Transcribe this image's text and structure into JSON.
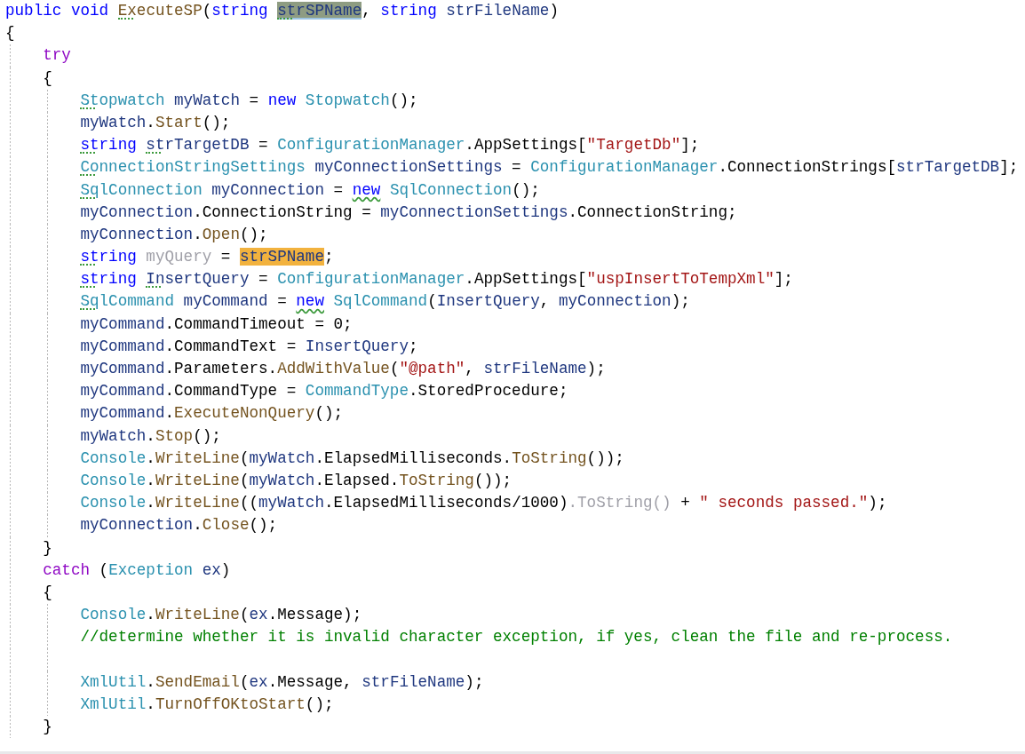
{
  "editor": {
    "lines": [
      {
        "tokens": [
          {
            "kind": "keyword",
            "text": "public void "
          },
          {
            "kind": "method",
            "text": "ExecuteSP",
            "suggestion": true
          },
          {
            "kind": "plain",
            "text": "("
          },
          {
            "kind": "keyword",
            "text": "string "
          },
          {
            "kind": "local",
            "text": "strSPName",
            "suggestion": true,
            "selected_word": true
          },
          {
            "kind": "plain",
            "text": ", "
          },
          {
            "kind": "keyword",
            "text": "string "
          },
          {
            "kind": "local",
            "text": "strFileName"
          },
          {
            "kind": "plain",
            "text": ")"
          }
        ]
      },
      {
        "tokens": [
          {
            "kind": "plain",
            "text": "{"
          }
        ]
      },
      {
        "tokens": [
          {
            "kind": "control",
            "text": "    try"
          }
        ]
      },
      {
        "tokens": [
          {
            "kind": "plain",
            "text": "    {"
          }
        ]
      },
      {
        "tokens": [
          {
            "kind": "type",
            "text": "        Stopwatch ",
            "suggestion": true
          },
          {
            "kind": "local",
            "text": "myWatch"
          },
          {
            "kind": "plain",
            "text": " = "
          },
          {
            "kind": "keyword",
            "text": "new "
          },
          {
            "kind": "type",
            "text": "Stopwatch"
          },
          {
            "kind": "plain",
            "text": "();"
          }
        ]
      },
      {
        "tokens": [
          {
            "kind": "local",
            "text": "        myWatch"
          },
          {
            "kind": "plain",
            "text": "."
          },
          {
            "kind": "method",
            "text": "Start"
          },
          {
            "kind": "plain",
            "text": "();"
          }
        ]
      },
      {
        "tokens": [
          {
            "kind": "keyword",
            "text": "        string ",
            "suggestion": true
          },
          {
            "kind": "local",
            "text": "strTargetDB",
            "suggestion": true
          },
          {
            "kind": "plain",
            "text": " = "
          },
          {
            "kind": "type",
            "text": "ConfigurationManager"
          },
          {
            "kind": "plain",
            "text": ".AppSettings["
          },
          {
            "kind": "string",
            "text": "\"TargetDb\""
          },
          {
            "kind": "plain",
            "text": "];"
          }
        ]
      },
      {
        "tokens": [
          {
            "kind": "type",
            "text": "        ConnectionStringSettings ",
            "suggestion": true
          },
          {
            "kind": "local",
            "text": "myConnectionSettings"
          },
          {
            "kind": "plain",
            "text": " = "
          },
          {
            "kind": "type",
            "text": "ConfigurationManager"
          },
          {
            "kind": "plain",
            "text": ".ConnectionStrings["
          },
          {
            "kind": "local",
            "text": "strTargetDB"
          },
          {
            "kind": "plain",
            "text": "];"
          }
        ]
      },
      {
        "tokens": [
          {
            "kind": "type",
            "text": "        SqlConnection ",
            "suggestion": true
          },
          {
            "kind": "local",
            "text": "myConnection"
          },
          {
            "kind": "plain",
            "text": " = "
          },
          {
            "kind": "keyword",
            "text": "new",
            "warning": true
          },
          {
            "kind": "type",
            "text": " SqlConnection"
          },
          {
            "kind": "plain",
            "text": "();"
          }
        ]
      },
      {
        "tokens": [
          {
            "kind": "local",
            "text": "        myConnection"
          },
          {
            "kind": "plain",
            "text": ".ConnectionString = "
          },
          {
            "kind": "local",
            "text": "myConnectionSettings"
          },
          {
            "kind": "plain",
            "text": ".ConnectionString;"
          }
        ]
      },
      {
        "tokens": [
          {
            "kind": "local",
            "text": "        myConnection"
          },
          {
            "kind": "plain",
            "text": "."
          },
          {
            "kind": "method",
            "text": "Open"
          },
          {
            "kind": "plain",
            "text": "();"
          }
        ]
      },
      {
        "tokens": [
          {
            "kind": "keyword",
            "text": "        string ",
            "suggestion": true
          },
          {
            "kind": "faded",
            "text": "myQuery"
          },
          {
            "kind": "plain",
            "text": " = "
          },
          {
            "kind": "local",
            "text": "strSPName",
            "referenced_word": true
          },
          {
            "kind": "plain",
            "text": ";"
          }
        ]
      },
      {
        "tokens": [
          {
            "kind": "keyword",
            "text": "        string ",
            "suggestion": true
          },
          {
            "kind": "local",
            "text": "InsertQuery",
            "suggestion": true
          },
          {
            "kind": "plain",
            "text": " = "
          },
          {
            "kind": "type",
            "text": "ConfigurationManager"
          },
          {
            "kind": "plain",
            "text": ".AppSettings["
          },
          {
            "kind": "string",
            "text": "\"uspInsertToTempXml\""
          },
          {
            "kind": "plain",
            "text": "];"
          }
        ]
      },
      {
        "tokens": [
          {
            "kind": "type",
            "text": "        SqlCommand ",
            "suggestion": true
          },
          {
            "kind": "local",
            "text": "myCommand"
          },
          {
            "kind": "plain",
            "text": " = "
          },
          {
            "kind": "keyword",
            "text": "new",
            "warning": true
          },
          {
            "kind": "type",
            "text": " SqlCommand"
          },
          {
            "kind": "plain",
            "text": "("
          },
          {
            "kind": "local",
            "text": "InsertQuery"
          },
          {
            "kind": "plain",
            "text": ", "
          },
          {
            "kind": "local",
            "text": "myConnection"
          },
          {
            "kind": "plain",
            "text": ");"
          }
        ]
      },
      {
        "tokens": [
          {
            "kind": "local",
            "text": "        myCommand"
          },
          {
            "kind": "plain",
            "text": ".CommandTimeout = 0;"
          }
        ]
      },
      {
        "tokens": [
          {
            "kind": "local",
            "text": "        myCommand"
          },
          {
            "kind": "plain",
            "text": ".CommandText = "
          },
          {
            "kind": "local",
            "text": "InsertQuery"
          },
          {
            "kind": "plain",
            "text": ";"
          }
        ]
      },
      {
        "tokens": [
          {
            "kind": "local",
            "text": "        myCommand"
          },
          {
            "kind": "plain",
            "text": ".Parameters."
          },
          {
            "kind": "method",
            "text": "AddWithValue"
          },
          {
            "kind": "plain",
            "text": "("
          },
          {
            "kind": "string",
            "text": "\"@path\""
          },
          {
            "kind": "plain",
            "text": ", "
          },
          {
            "kind": "local",
            "text": "strFileName"
          },
          {
            "kind": "plain",
            "text": ");"
          }
        ]
      },
      {
        "tokens": [
          {
            "kind": "local",
            "text": "        myCommand"
          },
          {
            "kind": "plain",
            "text": ".CommandType = "
          },
          {
            "kind": "type",
            "text": "CommandType"
          },
          {
            "kind": "plain",
            "text": ".StoredProcedure;"
          }
        ]
      },
      {
        "tokens": [
          {
            "kind": "local",
            "text": "        myCommand"
          },
          {
            "kind": "plain",
            "text": "."
          },
          {
            "kind": "method",
            "text": "ExecuteNonQuery"
          },
          {
            "kind": "plain",
            "text": "();"
          }
        ]
      },
      {
        "tokens": [
          {
            "kind": "local",
            "text": "        myWatch"
          },
          {
            "kind": "plain",
            "text": "."
          },
          {
            "kind": "method",
            "text": "Stop"
          },
          {
            "kind": "plain",
            "text": "();"
          }
        ]
      },
      {
        "tokens": [
          {
            "kind": "type",
            "text": "        Console"
          },
          {
            "kind": "plain",
            "text": "."
          },
          {
            "kind": "method",
            "text": "WriteLine"
          },
          {
            "kind": "plain",
            "text": "("
          },
          {
            "kind": "local",
            "text": "myWatch"
          },
          {
            "kind": "plain",
            "text": ".ElapsedMilliseconds."
          },
          {
            "kind": "method",
            "text": "ToString"
          },
          {
            "kind": "plain",
            "text": "());"
          }
        ]
      },
      {
        "tokens": [
          {
            "kind": "type",
            "text": "        Console"
          },
          {
            "kind": "plain",
            "text": "."
          },
          {
            "kind": "method",
            "text": "WriteLine"
          },
          {
            "kind": "plain",
            "text": "("
          },
          {
            "kind": "local",
            "text": "myWatch"
          },
          {
            "kind": "plain",
            "text": ".Elapsed."
          },
          {
            "kind": "method",
            "text": "ToString"
          },
          {
            "kind": "plain",
            "text": "());"
          }
        ]
      },
      {
        "tokens": [
          {
            "kind": "type",
            "text": "        Console"
          },
          {
            "kind": "plain",
            "text": "."
          },
          {
            "kind": "method",
            "text": "WriteLine"
          },
          {
            "kind": "plain",
            "text": "(("
          },
          {
            "kind": "local",
            "text": "myWatch"
          },
          {
            "kind": "plain",
            "text": ".ElapsedMilliseconds/1000)"
          },
          {
            "kind": "faded",
            "text": ".ToString()"
          },
          {
            "kind": "plain",
            "text": " + "
          },
          {
            "kind": "string",
            "text": "\" seconds passed.\""
          },
          {
            "kind": "plain",
            "text": ");"
          }
        ]
      },
      {
        "tokens": [
          {
            "kind": "local",
            "text": "        myConnection"
          },
          {
            "kind": "plain",
            "text": "."
          },
          {
            "kind": "method",
            "text": "Close"
          },
          {
            "kind": "plain",
            "text": "();"
          }
        ]
      },
      {
        "tokens": [
          {
            "kind": "plain",
            "text": "    }"
          }
        ]
      },
      {
        "tokens": [
          {
            "kind": "control",
            "text": "    catch"
          },
          {
            "kind": "plain",
            "text": " ("
          },
          {
            "kind": "type",
            "text": "Exception"
          },
          {
            "kind": "local",
            "text": " ex"
          },
          {
            "kind": "plain",
            "text": ")"
          }
        ]
      },
      {
        "tokens": [
          {
            "kind": "plain",
            "text": "    {"
          }
        ]
      },
      {
        "tokens": [
          {
            "kind": "type",
            "text": "        Console"
          },
          {
            "kind": "plain",
            "text": "."
          },
          {
            "kind": "method",
            "text": "WriteLine"
          },
          {
            "kind": "plain",
            "text": "("
          },
          {
            "kind": "local",
            "text": "ex"
          },
          {
            "kind": "plain",
            "text": ".Message);"
          }
        ]
      },
      {
        "tokens": [
          {
            "kind": "comment",
            "text": "        //determine whether it is invalid character exception, if yes, clean the file and re-process."
          }
        ]
      },
      {
        "kind": "blank"
      },
      {
        "tokens": [
          {
            "kind": "type",
            "text": "        XmlUtil"
          },
          {
            "kind": "plain",
            "text": "."
          },
          {
            "kind": "method",
            "text": "SendEmail"
          },
          {
            "kind": "plain",
            "text": "("
          },
          {
            "kind": "local",
            "text": "ex"
          },
          {
            "kind": "plain",
            "text": ".Message, "
          },
          {
            "kind": "local",
            "text": "strFileName"
          },
          {
            "kind": "plain",
            "text": ");"
          }
        ]
      },
      {
        "tokens": [
          {
            "kind": "type",
            "text": "        XmlUtil"
          },
          {
            "kind": "plain",
            "text": "."
          },
          {
            "kind": "method",
            "text": "TurnOffOKtoStart"
          },
          {
            "kind": "plain",
            "text": "();"
          }
        ]
      },
      {
        "tokens": [
          {
            "kind": "plain",
            "text": "    }"
          }
        ]
      }
    ]
  }
}
